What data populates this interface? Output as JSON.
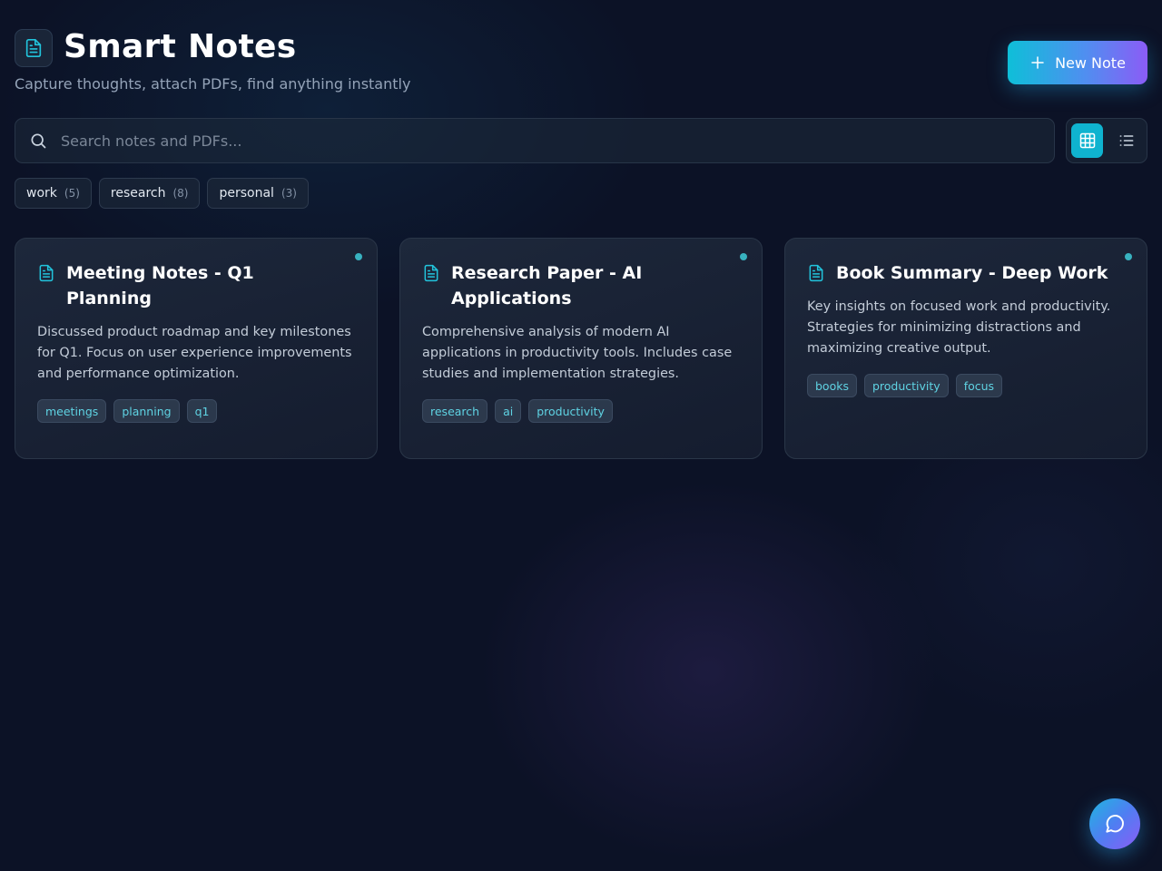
{
  "header": {
    "title": "Smart Notes",
    "subtitle": "Capture thoughts, attach PDFs, find anything instantly",
    "new_note_label": "New Note"
  },
  "search": {
    "placeholder": "Search notes and PDFs...",
    "value": ""
  },
  "view_toggle": {
    "active": "grid",
    "options": [
      "grid-icon",
      "list-icon"
    ]
  },
  "filters": [
    {
      "label": "work",
      "count": "(5)"
    },
    {
      "label": "research",
      "count": "(8)"
    },
    {
      "label": "personal",
      "count": "(3)"
    }
  ],
  "notes": [
    {
      "title": "Meeting Notes - Q1 Planning",
      "body": "Discussed product roadmap and key milestones for Q1. Focus on user experience improvements and performance optimization.",
      "tags": [
        "meetings",
        "planning",
        "q1"
      ]
    },
    {
      "title": "Research Paper - AI Applications",
      "body": "Comprehensive analysis of modern AI applications in productivity tools. Includes case studies and implementation strategies.",
      "tags": [
        "research",
        "ai",
        "productivity"
      ]
    },
    {
      "title": "Book Summary - Deep Work",
      "body": "Key insights on focused work and productivity. Strategies for minimizing distractions and maximizing creative output.",
      "tags": [
        "books",
        "productivity",
        "focus"
      ]
    }
  ],
  "colors": {
    "background": "#0c1226",
    "accent": "#0fb3cf",
    "accent_secondary": "#8b5cf6",
    "tag_text": "#5fd3e3"
  },
  "icons": {
    "app": "document-icon",
    "new_note": "plus-icon",
    "search": "search-icon",
    "card": "document-icon",
    "chat": "chat-bubble-icon"
  }
}
